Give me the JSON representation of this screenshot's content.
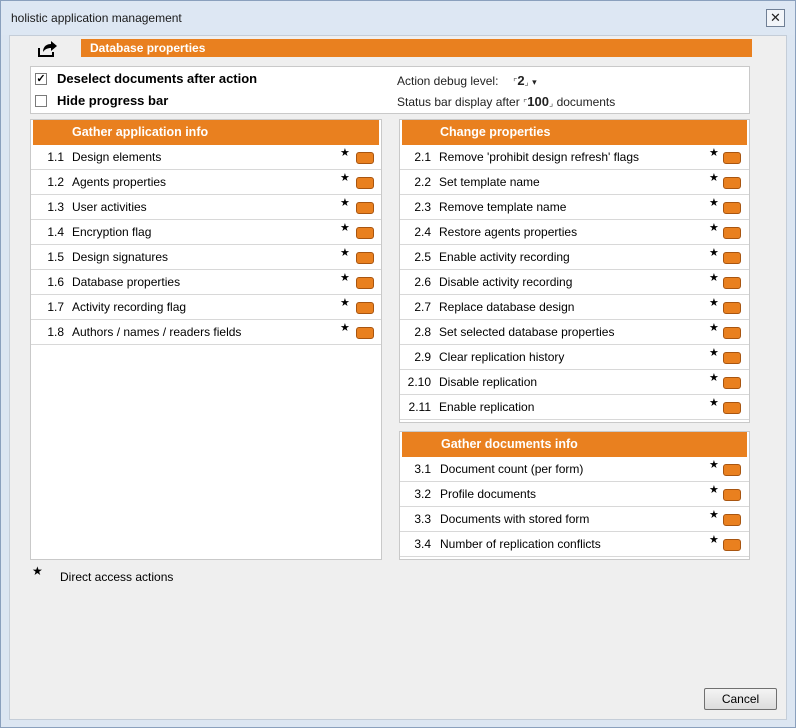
{
  "window": {
    "title": "holistic application management",
    "close_glyph": "✕"
  },
  "header": {
    "title": "Database properties",
    "icon": "share-arrow-icon"
  },
  "options": {
    "deselect": {
      "label": "Deselect documents after action",
      "checked": true,
      "check_glyph": "✓"
    },
    "hide_progress": {
      "label": "Hide progress bar",
      "checked": false
    },
    "debug_label": "Action debug level:",
    "debug_value": "2",
    "status_label_before": "Status bar display after",
    "status_value": "100",
    "status_label_after": "documents",
    "dropdown_glyph": "▾",
    "bracket_open": "⌜",
    "bracket_close": "⌟"
  },
  "panels": {
    "gather_app": {
      "title": "Gather application info",
      "items": [
        {
          "num": "1.1",
          "label": "Design elements"
        },
        {
          "num": "1.2",
          "label": "Agents properties"
        },
        {
          "num": "1.3",
          "label": "User activities"
        },
        {
          "num": "1.4",
          "label": "Encryption flag"
        },
        {
          "num": "1.5",
          "label": "Design signatures"
        },
        {
          "num": "1.6",
          "label": "Database properties"
        },
        {
          "num": "1.7",
          "label": "Activity recording flag"
        },
        {
          "num": "1.8",
          "label": "Authors / names / readers fields"
        }
      ]
    },
    "change_props": {
      "title": "Change properties",
      "items": [
        {
          "num": "2.1",
          "label": "Remove 'prohibit design refresh' flags"
        },
        {
          "num": "2.2",
          "label": "Set template name"
        },
        {
          "num": "2.3",
          "label": "Remove template name"
        },
        {
          "num": "2.4",
          "label": "Restore agents properties"
        },
        {
          "num": "2.5",
          "label": "Enable activity recording"
        },
        {
          "num": "2.6",
          "label": "Disable activity recording"
        },
        {
          "num": "2.7",
          "label": "Replace database design"
        },
        {
          "num": "2.8",
          "label": "Set selected database properties"
        },
        {
          "num": "2.9",
          "label": "Clear replication history"
        },
        {
          "num": "2.10",
          "label": "Disable replication"
        },
        {
          "num": "2.11",
          "label": "Enable replication"
        }
      ]
    },
    "gather_docs": {
      "title": "Gather documents info",
      "items": [
        {
          "num": "3.1",
          "label": "Document count (per form)"
        },
        {
          "num": "3.2",
          "label": "Profile documents"
        },
        {
          "num": "3.3",
          "label": "Documents with stored form"
        },
        {
          "num": "3.4",
          "label": "Number of replication conflicts"
        }
      ]
    }
  },
  "legend": {
    "star": "★",
    "text": "Direct access actions"
  },
  "footer": {
    "cancel_label": "Cancel"
  },
  "colors": {
    "accent": "#e9801f"
  }
}
